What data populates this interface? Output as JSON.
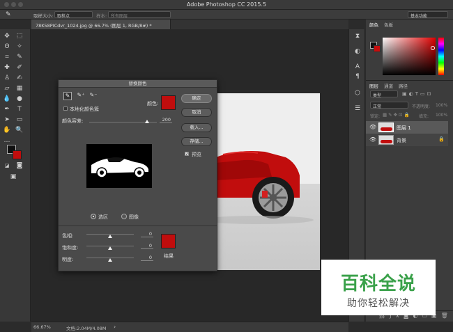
{
  "app": {
    "title": "Adobe Photoshop CC 2015.5"
  },
  "options_bar": {
    "sample_size_label": "取样大小:",
    "sample_size_value": "取样点",
    "sample_label": "样本:",
    "sample_value": "所有图层",
    "workspace": "基本功能"
  },
  "document": {
    "tab_label": "78K58PICdvr_1024.jpg @ 66.7% (图层 1, RGB/8#) *"
  },
  "status_bar": {
    "zoom": "66.67%",
    "doc_size": "文档:2.04M/4.08M"
  },
  "color_panel": {
    "tab_color": "颜色",
    "tab_swatches": "色板",
    "fg_color": "#101010",
    "bg_color": "#c80d0d"
  },
  "layers_panel": {
    "tabs": [
      "图层",
      "通道",
      "路径"
    ],
    "filter_kind": "类型",
    "blend_mode": "正常",
    "opacity_label": "不透明度:",
    "opacity_value": "100%",
    "lock_label": "锁定:",
    "fill_label": "填充:",
    "fill_value": "100%",
    "layers": [
      {
        "name": "图层 1",
        "selected": true
      },
      {
        "name": "背景",
        "selected": false
      }
    ]
  },
  "dialog": {
    "title": "替换颜色",
    "localized_label": "本地化颜色簇",
    "color_label": "颜色:",
    "fuzziness_label": "颜色容差:",
    "fuzziness_value": "200",
    "fuzziness_fraction": 0.86,
    "buttons": {
      "ok": "确定",
      "cancel": "取消",
      "load": "载入...",
      "save": "存储..."
    },
    "preview_label": "预览",
    "radio_selection": "选区",
    "radio_image": "图像",
    "hue_label": "色相:",
    "hue_value": "0",
    "saturation_label": "饱和度:",
    "saturation_value": "0",
    "lightness_label": "明度:",
    "lightness_value": "0",
    "result_label": "结果",
    "result_color": "#c00d0d"
  },
  "watermark": {
    "title": "百科全说",
    "subtitle": "助你轻松解决"
  }
}
